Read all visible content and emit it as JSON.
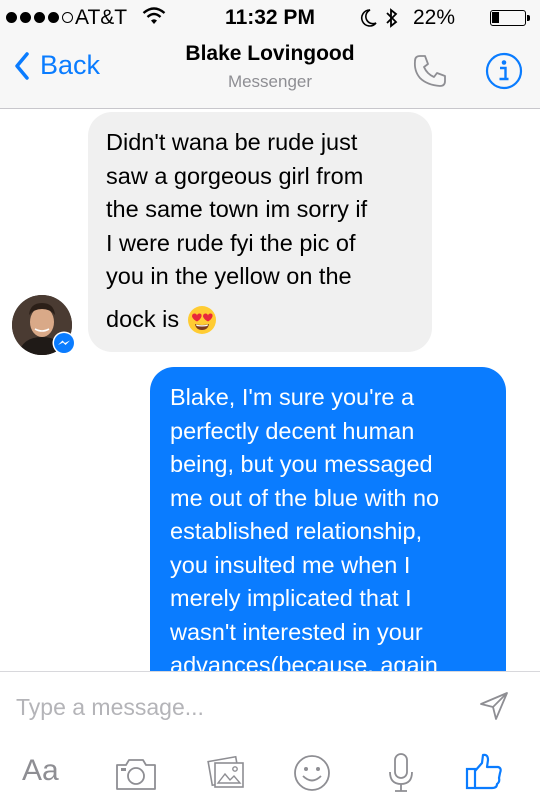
{
  "status_bar": {
    "carrier": "AT&T",
    "time": "11:32 PM",
    "battery_percent": "22%",
    "battery_level": 0.22,
    "signal_bars": 4
  },
  "nav": {
    "back_label": "Back",
    "contact_name": "Blake Lovingood",
    "subtitle": "Messenger",
    "accent_color": "#0a7cff"
  },
  "messages": [
    {
      "direction": "incoming",
      "lines": [
        "Didn't wana be rude just",
        "saw a gorgeous girl from",
        "the same town im sorry if",
        "I were rude fyi the pic of",
        "you in the yellow on the",
        "dock is"
      ],
      "emoji": "heart-eyes-emoji"
    },
    {
      "direction": "outgoing",
      "lines": [
        "Blake, I'm sure you're a",
        "perfectly decent human",
        "being, but you messaged",
        "me out of the blue with no",
        "established relationship,",
        "you insulted me when I",
        "merely implicated that I",
        "wasn't interested in your",
        "advances(because, again"
      ]
    }
  ],
  "composer": {
    "placeholder": "Type a message...",
    "value": "",
    "aa_label": "Aa",
    "icons": [
      "aa-icon",
      "camera-icon",
      "photos-icon",
      "emoji-icon",
      "microphone-icon",
      "like-icon"
    ]
  }
}
